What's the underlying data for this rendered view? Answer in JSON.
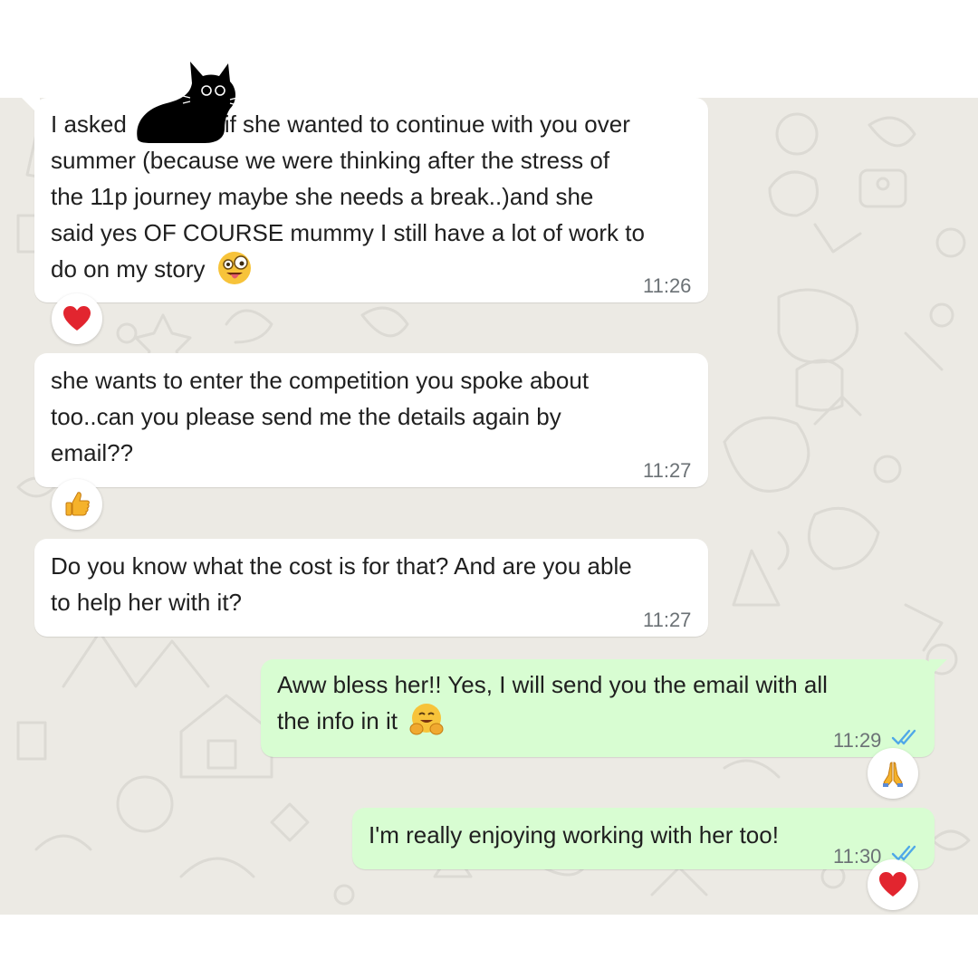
{
  "messages": [
    {
      "direction": "incoming",
      "lines": [
        "I asked",
        "if she wanted to continue with you over",
        "summer (because we were thinking after the stress of",
        "the 11p journey maybe she needs a break..)and she",
        "said yes OF COURSE mummy I still have a lot of work to",
        "do on my story"
      ],
      "inline_emoji": "zany-face-icon",
      "time": "11:26",
      "reaction": "red-heart-icon"
    },
    {
      "direction": "incoming",
      "lines": [
        "she wants to enter the competition you spoke about",
        "too..can you please send me the details again by",
        "email??"
      ],
      "time": "11:27",
      "reaction": "thumbs-up-icon"
    },
    {
      "direction": "incoming",
      "lines": [
        "Do you know what the cost is for that? And are you able",
        "to help her with it?"
      ],
      "time": "11:27"
    },
    {
      "direction": "outgoing",
      "lines": [
        "Aww bless her!! Yes, I will send you the email with all",
        "the info in it"
      ],
      "inline_emoji": "hugging-face-icon",
      "time": "11:29",
      "status": "read-double-check-icon",
      "reaction": "folded-hands-icon"
    },
    {
      "direction": "outgoing",
      "lines": [
        "I'm really enjoying working with her too!"
      ],
      "time": "11:30",
      "status": "read-double-check-icon",
      "reaction": "red-heart-icon"
    }
  ],
  "overlay": {
    "icon": "black-cat-sticker-icon"
  },
  "colors": {
    "chat_background": "#eceae4",
    "incoming_bubble": "#ffffff",
    "outgoing_bubble": "#d8fdd2",
    "read_ticks": "#4fa8e8",
    "time_text": "#6b7175"
  }
}
